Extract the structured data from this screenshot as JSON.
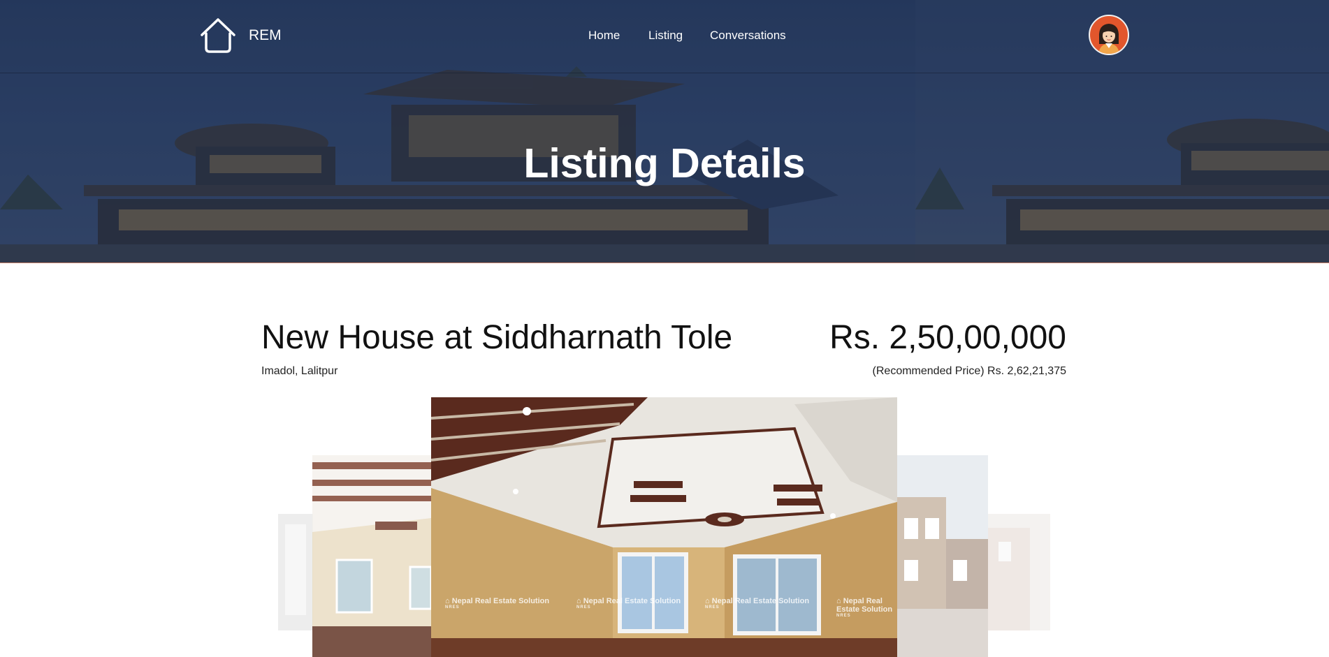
{
  "header": {
    "brand": "REM",
    "nav": {
      "home": "Home",
      "listing": "Listing",
      "conversations": "Conversations"
    }
  },
  "hero": {
    "title": "Listing Details"
  },
  "listing": {
    "title": "New House at Siddharnath Tole",
    "location": "Imadol, Lalitpur",
    "price": "Rs. 2,50,00,000",
    "recommended_price": "(Recommended Price) Rs. 2,62,21,375"
  },
  "carousel": {
    "watermark": "Nepal Real Estate Solution",
    "watermark_short": "NRES"
  },
  "colors": {
    "hero_bg": "#2f4468",
    "avatar_bg": "#e2562c",
    "accent_line": "#c9826c"
  }
}
